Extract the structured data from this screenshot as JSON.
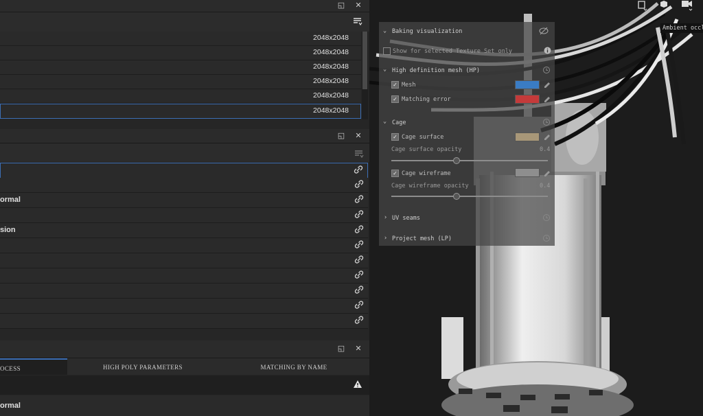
{
  "texture_sets": {
    "resolutions": [
      "2048x2048",
      "2048x2048",
      "2048x2048",
      "2048x2048",
      "2048x2048",
      "2048x2048"
    ]
  },
  "maps": {
    "rows": [
      "",
      "",
      "ormal",
      "",
      "sion",
      "",
      "",
      "",
      "",
      "",
      ""
    ]
  },
  "baking_tabs": {
    "tab1": "OCESS",
    "tab2": "HIGH POLY PARAMETERS",
    "tab3": "MATCHING BY NAME"
  },
  "bottom_label": "ormal",
  "viewport": {
    "tooltip": "Ambient occl",
    "overlay": {
      "baking_visualization": "Baking visualization",
      "show_selected": "Show for selected Texture Set only",
      "hp_section": "High definition mesh (HP)",
      "mesh": "Mesh",
      "matching_error": "Matching error",
      "cage_section": "Cage",
      "cage_surface": "Cage surface",
      "cage_surface_opacity": "Cage surface opacity",
      "cage_surface_opacity_value": "0.4",
      "cage_wireframe": "Cage wireframe",
      "cage_wireframe_opacity": "Cage wireframe opacity",
      "cage_wireframe_opacity_value": "0.4",
      "uv_seams": "UV seams",
      "project_mesh": "Project mesh (LP)"
    }
  },
  "colors": {
    "accent": "#3c6eb4",
    "mesh_swatch": "#3a7cc4",
    "matching_error_swatch": "#c43a3a",
    "cage_surface_swatch": "#a89778",
    "cage_wireframe_swatch": "#8e8e8e"
  }
}
